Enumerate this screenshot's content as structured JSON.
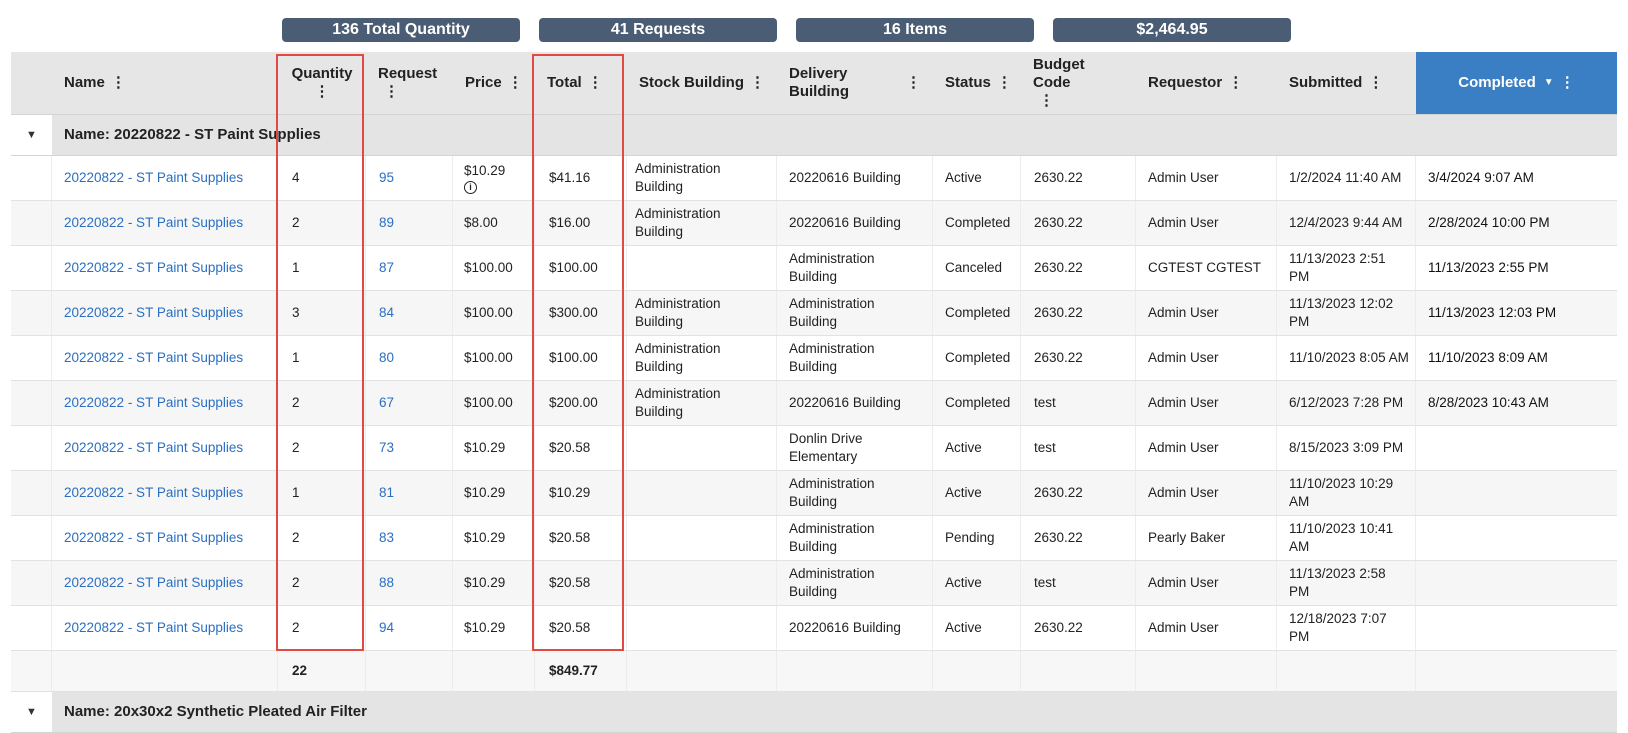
{
  "summary": {
    "total_quantity": "136 Total Quantity",
    "requests": "41 Requests",
    "items": "16 Items",
    "total_cost": "$2,464.95"
  },
  "columns": {
    "name": "Name",
    "quantity": "Quantity",
    "request": "Request",
    "price": "Price",
    "total": "Total",
    "stock_building": "Stock Building",
    "delivery_building": "Delivery Building",
    "status": "Status",
    "budget_code": "Budget Code",
    "requestor": "Requestor",
    "submitted": "Submitted",
    "completed": "Completed"
  },
  "icons": {
    "kebab": "⋮",
    "sort": "▼",
    "collapse_caret": "▼",
    "info": "i"
  },
  "groups": [
    {
      "label": "Name: 20220822 - ST Paint Supplies",
      "rows": [
        {
          "name": "20220822 - ST Paint Supplies",
          "quantity": "4",
          "request": "95",
          "price": "$10.29",
          "total": "$41.16",
          "stock": "Administration Building",
          "delivery": "20220616 Building",
          "status": "Active",
          "budget": "2630.22",
          "requestor": "Admin User",
          "submitted": "1/2/2024 11:40 AM",
          "completed": "3/4/2024 9:07 AM"
        },
        {
          "name": "20220822 - ST Paint Supplies",
          "quantity": "2",
          "request": "89",
          "price": "$8.00",
          "total": "$16.00",
          "stock": "Administration Building",
          "delivery": "20220616 Building",
          "status": "Completed",
          "budget": "2630.22",
          "requestor": "Admin User",
          "submitted": "12/4/2023 9:44 AM",
          "completed": "2/28/2024 10:00 PM"
        },
        {
          "name": "20220822 - ST Paint Supplies",
          "quantity": "1",
          "request": "87",
          "price": "$100.00",
          "total": "$100.00",
          "stock": "",
          "delivery": "Administration Building",
          "status": "Canceled",
          "budget": "2630.22",
          "requestor": "CGTEST CGTEST",
          "submitted": "11/13/2023 2:51 PM",
          "completed": "11/13/2023 2:55 PM"
        },
        {
          "name": "20220822 - ST Paint Supplies",
          "quantity": "3",
          "request": "84",
          "price": "$100.00",
          "total": "$300.00",
          "stock": "Administration Building",
          "delivery": "Administration Building",
          "status": "Completed",
          "budget": "2630.22",
          "requestor": "Admin User",
          "submitted": "11/13/2023 12:02 PM",
          "completed": "11/13/2023 12:03 PM"
        },
        {
          "name": "20220822 - ST Paint Supplies",
          "quantity": "1",
          "request": "80",
          "price": "$100.00",
          "total": "$100.00",
          "stock": "Administration Building",
          "delivery": "Administration Building",
          "status": "Completed",
          "budget": "2630.22",
          "requestor": "Admin User",
          "submitted": "11/10/2023 8:05 AM",
          "completed": "11/10/2023 8:09 AM"
        },
        {
          "name": "20220822 - ST Paint Supplies",
          "quantity": "2",
          "request": "67",
          "price": "$100.00",
          "total": "$200.00",
          "stock": "Administration Building",
          "delivery": "20220616 Building",
          "status": "Completed",
          "budget": "test",
          "requestor": "Admin User",
          "submitted": "6/12/2023 7:28 PM",
          "completed": "8/28/2023 10:43 AM"
        },
        {
          "name": "20220822 - ST Paint Supplies",
          "quantity": "2",
          "request": "73",
          "price": "$10.29",
          "total": "$20.58",
          "stock": "",
          "delivery": "Donlin Drive Elementary",
          "status": "Active",
          "budget": "test",
          "requestor": "Admin User",
          "submitted": "8/15/2023 3:09 PM",
          "completed": ""
        },
        {
          "name": "20220822 - ST Paint Supplies",
          "quantity": "1",
          "request": "81",
          "price": "$10.29",
          "total": "$10.29",
          "stock": "",
          "delivery": "Administration Building",
          "status": "Active",
          "budget": "2630.22",
          "requestor": "Admin User",
          "submitted": "11/10/2023 10:29 AM",
          "completed": ""
        },
        {
          "name": "20220822 - ST Paint Supplies",
          "quantity": "2",
          "request": "83",
          "price": "$10.29",
          "total": "$20.58",
          "stock": "",
          "delivery": "Administration Building",
          "status": "Pending",
          "budget": "2630.22",
          "requestor": "Pearly Baker",
          "submitted": "11/10/2023 10:41 AM",
          "completed": ""
        },
        {
          "name": "20220822 - ST Paint Supplies",
          "quantity": "2",
          "request": "88",
          "price": "$10.29",
          "total": "$20.58",
          "stock": "",
          "delivery": "Administration Building",
          "status": "Active",
          "budget": "test",
          "requestor": "Admin User",
          "submitted": "11/13/2023 2:58 PM",
          "completed": ""
        },
        {
          "name": "20220822 - ST Paint Supplies",
          "quantity": "2",
          "request": "94",
          "price": "$10.29",
          "total": "$20.58",
          "stock": "",
          "delivery": "20220616 Building",
          "status": "Active",
          "budget": "2630.22",
          "requestor": "Admin User",
          "submitted": "12/18/2023 7:07 PM",
          "completed": ""
        }
      ],
      "footer": {
        "quantity": "22",
        "total": "$849.77"
      }
    },
    {
      "label": "Name: 20x30x2 Synthetic Pleated Air Filter"
    }
  ],
  "colors": {
    "pill_bg": "#4b5d74",
    "header_bg": "#e6e6e6",
    "active_header_bg": "#3a7fc3",
    "link": "#2a6fc2",
    "highlight": "#e14a43"
  }
}
